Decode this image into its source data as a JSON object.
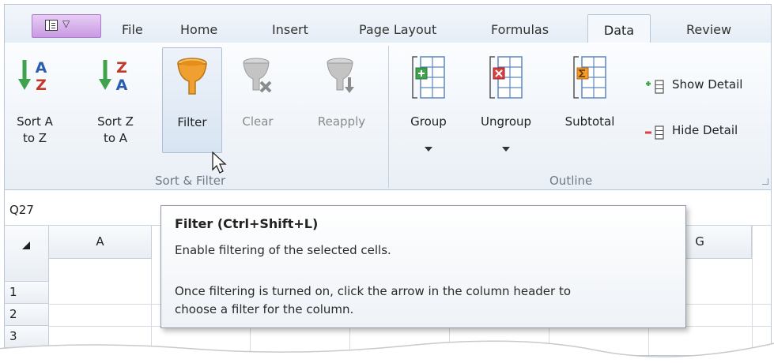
{
  "tabs": [
    {
      "label": "File",
      "active": false
    },
    {
      "label": "Home",
      "active": false
    },
    {
      "label": "Insert",
      "active": false
    },
    {
      "label": "Page Layout",
      "active": false
    },
    {
      "label": "Formulas",
      "active": false
    },
    {
      "label": "Data",
      "active": true
    },
    {
      "label": "Review",
      "active": false
    }
  ],
  "ribbon": {
    "sort_filter": {
      "group_label": "Sort & Filter",
      "sort_az": {
        "line1": "Sort A",
        "line2": "to Z"
      },
      "sort_za": {
        "line1": "Sort Z",
        "line2": "to A"
      },
      "filter": {
        "label": "Filter"
      },
      "clear": {
        "label": "Clear"
      },
      "reapply": {
        "label": "Reapply"
      }
    },
    "outline": {
      "group_label": "Outline",
      "group": {
        "label": "Group"
      },
      "ungroup": {
        "label": "Ungroup"
      },
      "subtotal": {
        "label": "Subtotal"
      },
      "show_detail": {
        "label": "Show Detail"
      },
      "hide_detail": {
        "label": "Hide Detail"
      }
    }
  },
  "formula_bar": {
    "name_box": "Q27"
  },
  "grid": {
    "columns": [
      "A",
      "G"
    ],
    "rows": [
      "1",
      "2",
      "3"
    ]
  },
  "tooltip": {
    "title": "Filter (Ctrl+Shift+L)",
    "line1": "Enable filtering of the selected cells.",
    "line2": "Once filtering is turned on, click the arrow in the column header to",
    "line3": "choose a filter for the column."
  },
  "colors": {
    "app_menu": "#c99ae2",
    "sort_arrow_green": "#3fa34d",
    "sort_letter_blue": "#2a5db0",
    "filter_orange": "#f0a030",
    "group_green": "#3fa34d",
    "ungroup_red": "#d94040",
    "subtotal_orange": "#f39a2a"
  }
}
